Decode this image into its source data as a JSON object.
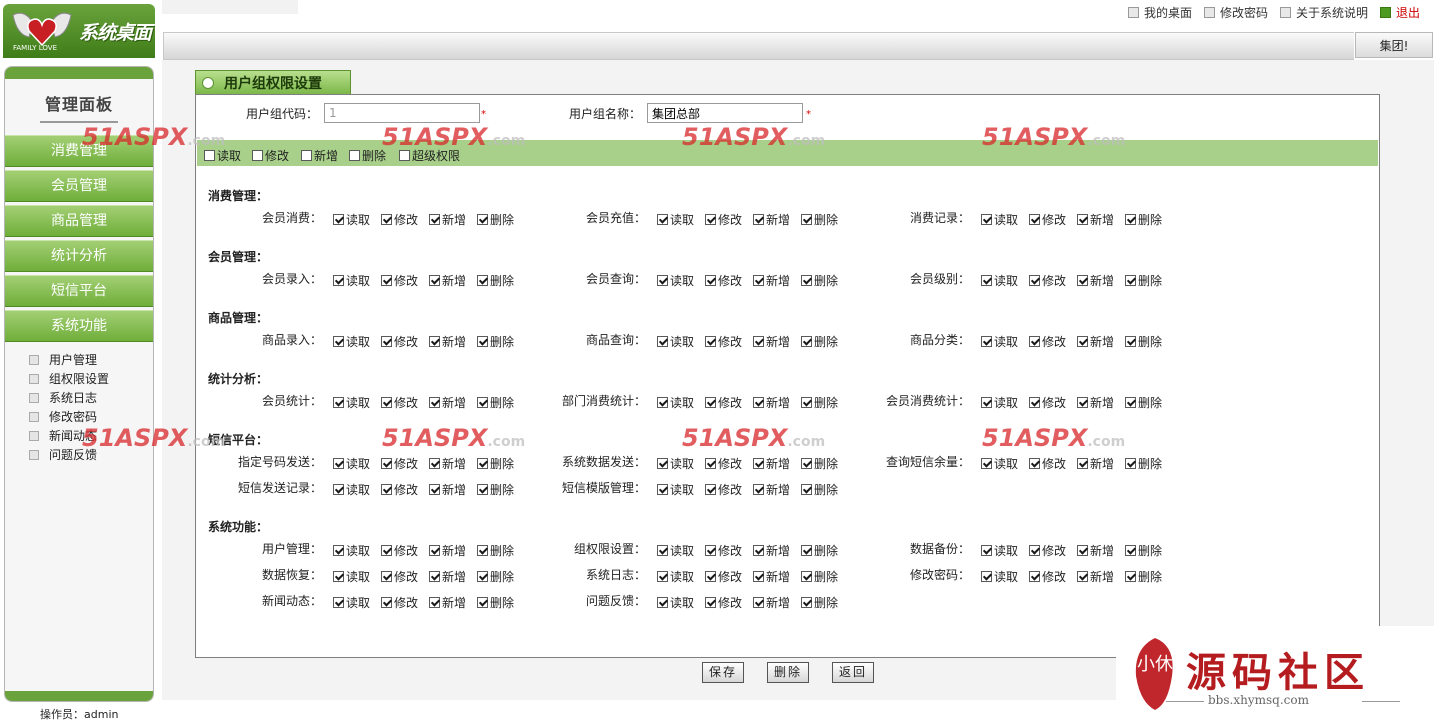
{
  "header": {
    "logo_text": "系统桌面",
    "logo_sub": "FAMILY LOVE",
    "links": [
      {
        "label": "我的桌面"
      },
      {
        "label": "修改密码"
      },
      {
        "label": "关于系统说明"
      },
      {
        "label": "退出"
      }
    ],
    "user_tab": "集团!"
  },
  "sidebar": {
    "title": "管理面板",
    "menu": [
      "消费管理",
      "会员管理",
      "商品管理",
      "统计分析",
      "短信平台",
      "系统功能"
    ],
    "submenu": [
      "用户管理",
      "组权限设置",
      "系统日志",
      "修改密码",
      "新闻动态",
      "问题反馈"
    ],
    "operator": "操作员：admin"
  },
  "page": {
    "tab_title": "用户组权限设置",
    "group_code_label": "用户组代码：",
    "group_code_value": "1",
    "group_name_label": "用户组名称：",
    "group_name_value": "集团总部",
    "required_mark": "*"
  },
  "global_permissions": [
    {
      "label": "读取",
      "checked": false
    },
    {
      "label": "修改",
      "checked": false
    },
    {
      "label": "新增",
      "checked": false
    },
    {
      "label": "删除",
      "checked": false
    },
    {
      "label": "超级权限",
      "checked": false
    }
  ],
  "perm_labels": [
    "读取",
    "修改",
    "新增",
    "删除"
  ],
  "sections": [
    {
      "title": "消费管理：",
      "rows": [
        [
          "会员消费：",
          "会员充值：",
          "消费记录："
        ]
      ]
    },
    {
      "title": "会员管理：",
      "rows": [
        [
          "会员录入：",
          "会员查询：",
          "会员级别："
        ]
      ]
    },
    {
      "title": "商品管理：",
      "rows": [
        [
          "商品录入：",
          "商品查询：",
          "商品分类："
        ]
      ]
    },
    {
      "title": "统计分析：",
      "rows": [
        [
          "会员统计：",
          "部门消费统计：",
          "会员消费统计："
        ]
      ]
    },
    {
      "title": "短信平台：",
      "rows": [
        [
          "指定号码发送：",
          "系统数据发送：",
          "查询短信余量："
        ],
        [
          "短信发送记录：",
          "短信模版管理："
        ]
      ]
    },
    {
      "title": "系统功能：",
      "rows": [
        [
          "用户管理：",
          "组权限设置：",
          "数据备份："
        ],
        [
          "数据恢复：",
          "系统日志：",
          "修改密码："
        ],
        [
          "新闻动态：",
          "问题反馈："
        ]
      ]
    }
  ],
  "buttons": {
    "save": "保存",
    "delete": "删除",
    "back": "返回"
  },
  "watermark": {
    "main": "51ASPX",
    "suffix": ".com"
  },
  "corner_logo": {
    "seal": "小休",
    "title": "源码社区",
    "url": "bbs.xhymsq.com"
  },
  "colors": {
    "accent_green": "#6aa33c",
    "highlight_bar": "#a8d08a",
    "logout_red": "#cc0000",
    "watermark_red": "#d8282b"
  }
}
